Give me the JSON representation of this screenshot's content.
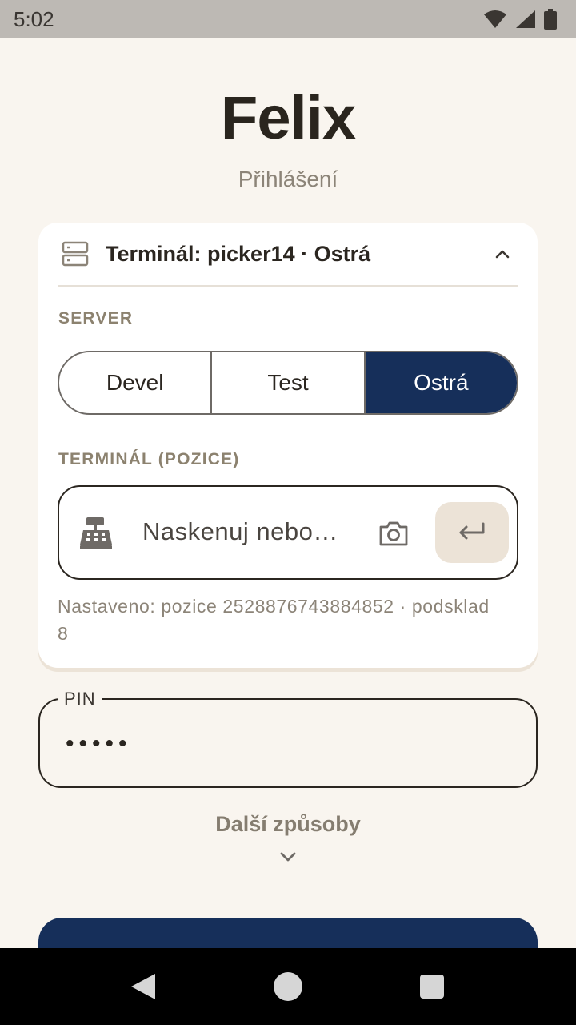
{
  "status_bar": {
    "time": "5:02"
  },
  "app": {
    "title": "Felix",
    "subtitle": "Přihlášení"
  },
  "terminal_card": {
    "header": "Terminál: picker14 · Ostrá",
    "server_label": "SERVER",
    "server_options": [
      "Devel",
      "Test",
      "Ostrá"
    ],
    "server_selected": "Ostrá",
    "terminal_label": "TERMINÁL (POZICE)",
    "terminal_input_value": "Naskenuj nebo…",
    "hint": "Nastaveno: pozice 2528876743884852 · podsklad 8"
  },
  "pin": {
    "label": "PIN",
    "value": "•••••"
  },
  "more_ways": "Další způsoby",
  "colors": {
    "primary": "#162f5a",
    "background": "#f9f5ef",
    "accent_soft": "#ece3d7"
  },
  "icons": [
    "wifi-icon",
    "signal-icon",
    "battery-icon",
    "server-icon",
    "chevron-up-icon",
    "cash-register-icon",
    "camera-icon",
    "enter-icon",
    "chevron-down-icon"
  ]
}
